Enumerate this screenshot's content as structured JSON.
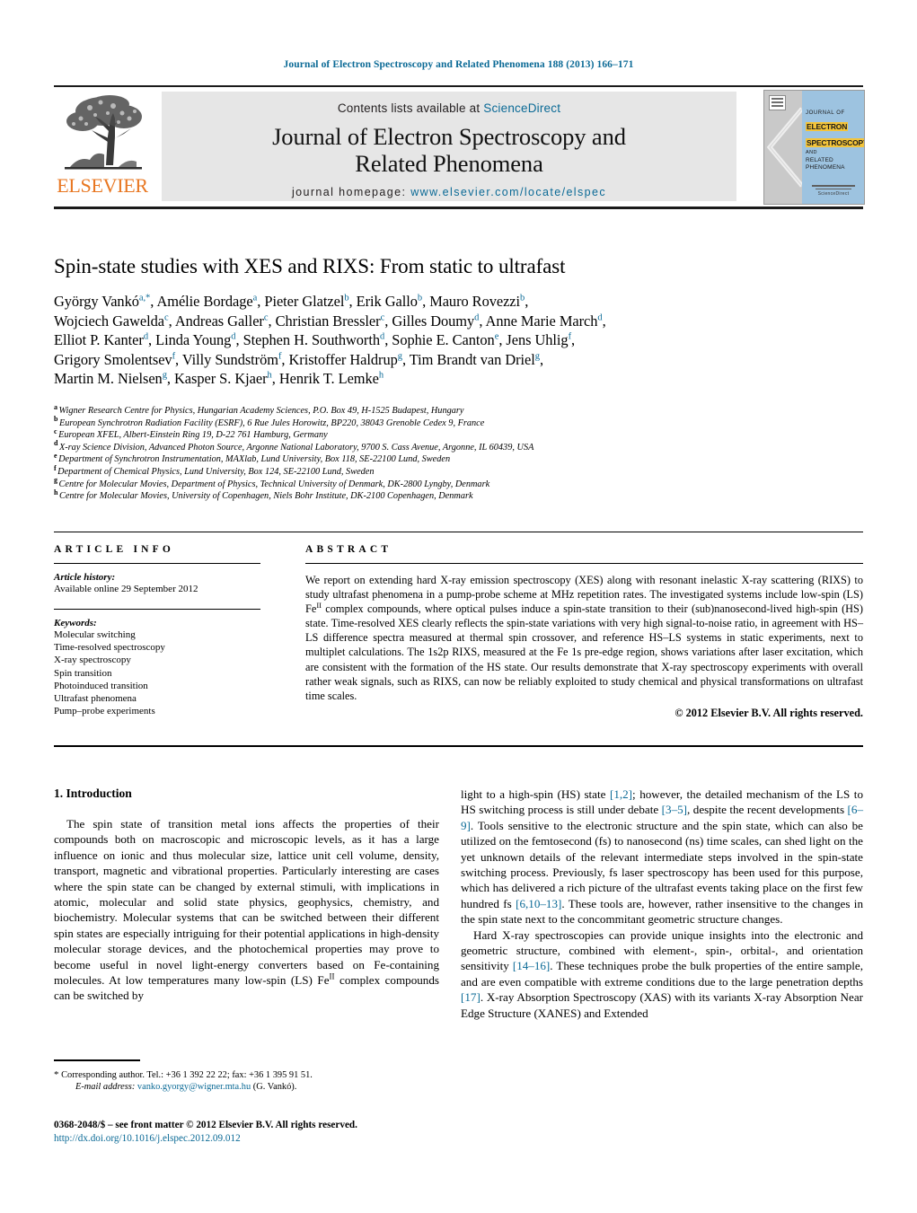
{
  "running_head": "Journal of Electron Spectroscopy and Related Phenomena 188 (2013) 166–171",
  "masthead": {
    "publisher_logo_label": "ELSEVIER",
    "contents_prefix": "Contents lists available at ",
    "contents_link": "ScienceDirect",
    "journal_title_line1": "Journal of Electron Spectroscopy and",
    "journal_title_line2": "Related Phenomena",
    "homepage_prefix": "journal homepage: ",
    "homepage_url": "www.elsevier.com/locate/elspec",
    "cover": {
      "line1": "JOURNAL OF",
      "highlight1": "ELECTRON",
      "highlight2": "SPECTROSCOPY",
      "small_and": "AND",
      "line4": "RELATED PHENOMENA",
      "footer": "ScienceDirect"
    }
  },
  "article": {
    "title": "Spin-state studies with XES and RIXS: From static to ultrafast",
    "authors": [
      {
        "name": "György Vankó",
        "marks": "a,*",
        "sep": ", "
      },
      {
        "name": "Amélie Bordage",
        "marks": "a",
        "sep": ", "
      },
      {
        "name": "Pieter Glatzel",
        "marks": "b",
        "sep": ", "
      },
      {
        "name": "Erik Gallo",
        "marks": "b",
        "sep": ", "
      },
      {
        "name": "Mauro Rovezzi",
        "marks": "b",
        "sep": ",\n"
      },
      {
        "name": "Wojciech Gawelda",
        "marks": "c",
        "sep": ", "
      },
      {
        "name": "Andreas Galler",
        "marks": "c",
        "sep": ", "
      },
      {
        "name": "Christian Bressler",
        "marks": "c",
        "sep": ", "
      },
      {
        "name": "Gilles Doumy",
        "marks": "d",
        "sep": ", "
      },
      {
        "name": "Anne Marie March",
        "marks": "d",
        "sep": ",\n"
      },
      {
        "name": "Elliot P. Kanter",
        "marks": "d",
        "sep": ", "
      },
      {
        "name": "Linda Young",
        "marks": "d",
        "sep": ", "
      },
      {
        "name": "Stephen H. Southworth",
        "marks": "d",
        "sep": ", "
      },
      {
        "name": "Sophie E. Canton",
        "marks": "e",
        "sep": ", "
      },
      {
        "name": "Jens Uhlig",
        "marks": "f",
        "sep": ",\n"
      },
      {
        "name": "Grigory Smolentsev",
        "marks": "f",
        "sep": ", "
      },
      {
        "name": "Villy Sundström",
        "marks": "f",
        "sep": ", "
      },
      {
        "name": "Kristoffer Haldrup",
        "marks": "g",
        "sep": ", "
      },
      {
        "name": "Tim Brandt van Driel",
        "marks": "g",
        "sep": ",\n"
      },
      {
        "name": "Martin M. Nielsen",
        "marks": "g",
        "sep": ", "
      },
      {
        "name": "Kasper S. Kjaer",
        "marks": "h",
        "sep": ", "
      },
      {
        "name": "Henrik T. Lemke",
        "marks": "h",
        "sep": ""
      }
    ],
    "affiliations": [
      {
        "mark": "a",
        "text": "Wigner Research Centre for Physics, Hungarian Academy Sciences, P.O. Box 49, H-1525 Budapest, Hungary"
      },
      {
        "mark": "b",
        "text": "European Synchrotron Radiation Facility (ESRF), 6 Rue Jules Horowitz, BP220, 38043 Grenoble Cedex 9, France"
      },
      {
        "mark": "c",
        "text": "European XFEL, Albert-Einstein Ring 19, D-22 761 Hamburg, Germany"
      },
      {
        "mark": "d",
        "text": "X-ray Science Division, Advanced Photon Source, Argonne National Laboratory, 9700 S. Cass Avenue, Argonne, IL 60439, USA"
      },
      {
        "mark": "e",
        "text": "Department of Synchrotron Instrumentation, MAXlab, Lund University, Box 118, SE-22100 Lund, Sweden"
      },
      {
        "mark": "f",
        "text": "Department of Chemical Physics, Lund University, Box 124, SE-22100 Lund, Sweden"
      },
      {
        "mark": "g",
        "text": "Centre for Molecular Movies, Department of Physics, Technical University of Denmark, DK-2800 Lyngby, Denmark"
      },
      {
        "mark": "h",
        "text": "Centre for Molecular Movies, University of Copenhagen, Niels Bohr Institute, DK-2100 Copenhagen, Denmark"
      }
    ]
  },
  "article_info": {
    "heading": "ARTICLE INFO",
    "history_label": "Article history:",
    "history_value": "Available online 29 September 2012",
    "keywords_label": "Keywords:",
    "keywords": [
      "Molecular switching",
      "Time-resolved spectroscopy",
      "X-ray spectroscopy",
      "Spin transition",
      "Photoinduced transition",
      "Ultrafast phenomena",
      "Pump–probe experiments"
    ]
  },
  "abstract": {
    "heading": "ABSTRACT",
    "text_part1": "We report on extending hard X-ray emission spectroscopy (XES) along with resonant inelastic X-ray scattering (RIXS) to study ultrafast phenomena in a pump-probe scheme at MHz repetition rates. The investigated systems include low-spin (LS) Fe",
    "fe_superscript": "II",
    "text_part2": " complex compounds, where optical pulses induce a spin-state transition to their (sub)nanosecond-lived high-spin (HS) state. Time-resolved XES clearly reflects the spin-state variations with very high signal-to-noise ratio, in agreement with HS–LS difference spectra measured at thermal spin crossover, and reference HS–LS systems in static experiments, next to multiplet calculations. The 1s2p RIXS, measured at the Fe 1s pre-edge region, shows variations after laser excitation, which are consistent with the formation of the HS state. Our results demonstrate that X-ray spectroscopy experiments with overall rather weak signals, such as RIXS, can now be reliably exploited to study chemical and physical transformations on ultrafast time scales.",
    "copyright": "© 2012 Elsevier B.V. All rights reserved."
  },
  "introduction": {
    "heading": "1. Introduction",
    "left_p1_a": "The spin state of transition metal ions affects the properties of their compounds both on macroscopic and microscopic levels, as it has a large influence on ionic and thus molecular size, lattice unit cell volume, density, transport, magnetic and vibrational properties. Particularly interesting are cases where the spin state can be changed by external stimuli, with implications in atomic, molecular and solid state physics, geophysics, chemistry, and biochemistry. Molecular systems that can be switched between their different spin states are especially intriguing for their potential applications in high-density molecular storage devices, and the photochemical properties may prove to become useful in novel light-energy converters based on Fe-containing molecules. At low temperatures many low-spin (LS) Fe",
    "left_p1_fe_sup": "II",
    "left_p1_b": " complex compounds can be switched by",
    "right_p1_a": "light to a high-spin (HS) state ",
    "right_ref_1": "[1,2]",
    "right_p1_b": "; however, the detailed mechanism of the LS to HS switching process is still under debate ",
    "right_ref_2": "[3–5]",
    "right_p1_c": ", despite the recent developments ",
    "right_ref_3": "[6–9]",
    "right_p1_d": ". Tools sensitive to the electronic structure and the spin state, which can also be utilized on the femtosecond (fs) to nanosecond (ns) time scales, can shed light on the yet unknown details of the relevant intermediate steps involved in the spin-state switching process. Previously, fs laser spectroscopy has been used for this purpose, which has delivered a rich picture of the ultrafast events taking place on the first few hundred fs ",
    "right_ref_4": "[6,10–13]",
    "right_p1_e": ". These tools are, however, rather insensitive to the changes in the spin state next to the concommitant geometric structure changes.",
    "right_p2_a": "Hard X-ray spectroscopies can provide unique insights into the electronic and geometric structure, combined with element-, spin-, orbital-, and orientation sensitivity ",
    "right_ref_5": "[14–16]",
    "right_p2_b": ". These techniques probe the bulk properties of the entire sample, and are even compatible with extreme conditions due to the large penetration depths ",
    "right_ref_6": "[17]",
    "right_p2_c": ". X-ray Absorption Spectroscopy (XAS) with its variants X-ray Absorption Near Edge Structure (XANES) and Extended"
  },
  "footnote": {
    "star": "*",
    "corresponding": " Corresponding author. Tel.: +36 1 392 22 22; fax: +36 1 395 91 51.",
    "email_label": "E-mail address:",
    "email": "vanko.gyorgy@wigner.mta.hu",
    "email_suffix": " (G. Vankó)."
  },
  "footer": {
    "issn_line": "0368-2048/$ – see front matter © 2012 Elsevier B.V. All rights reserved.",
    "doi": "http://dx.doi.org/10.1016/j.elspec.2012.09.012"
  },
  "colors": {
    "link_blue": "#0b6a96",
    "elsevier_orange": "#e87722",
    "banner_gray": "#e6e6e6",
    "cover_blue": "#9dc3e0",
    "cover_highlight": "#f3c43a"
  }
}
